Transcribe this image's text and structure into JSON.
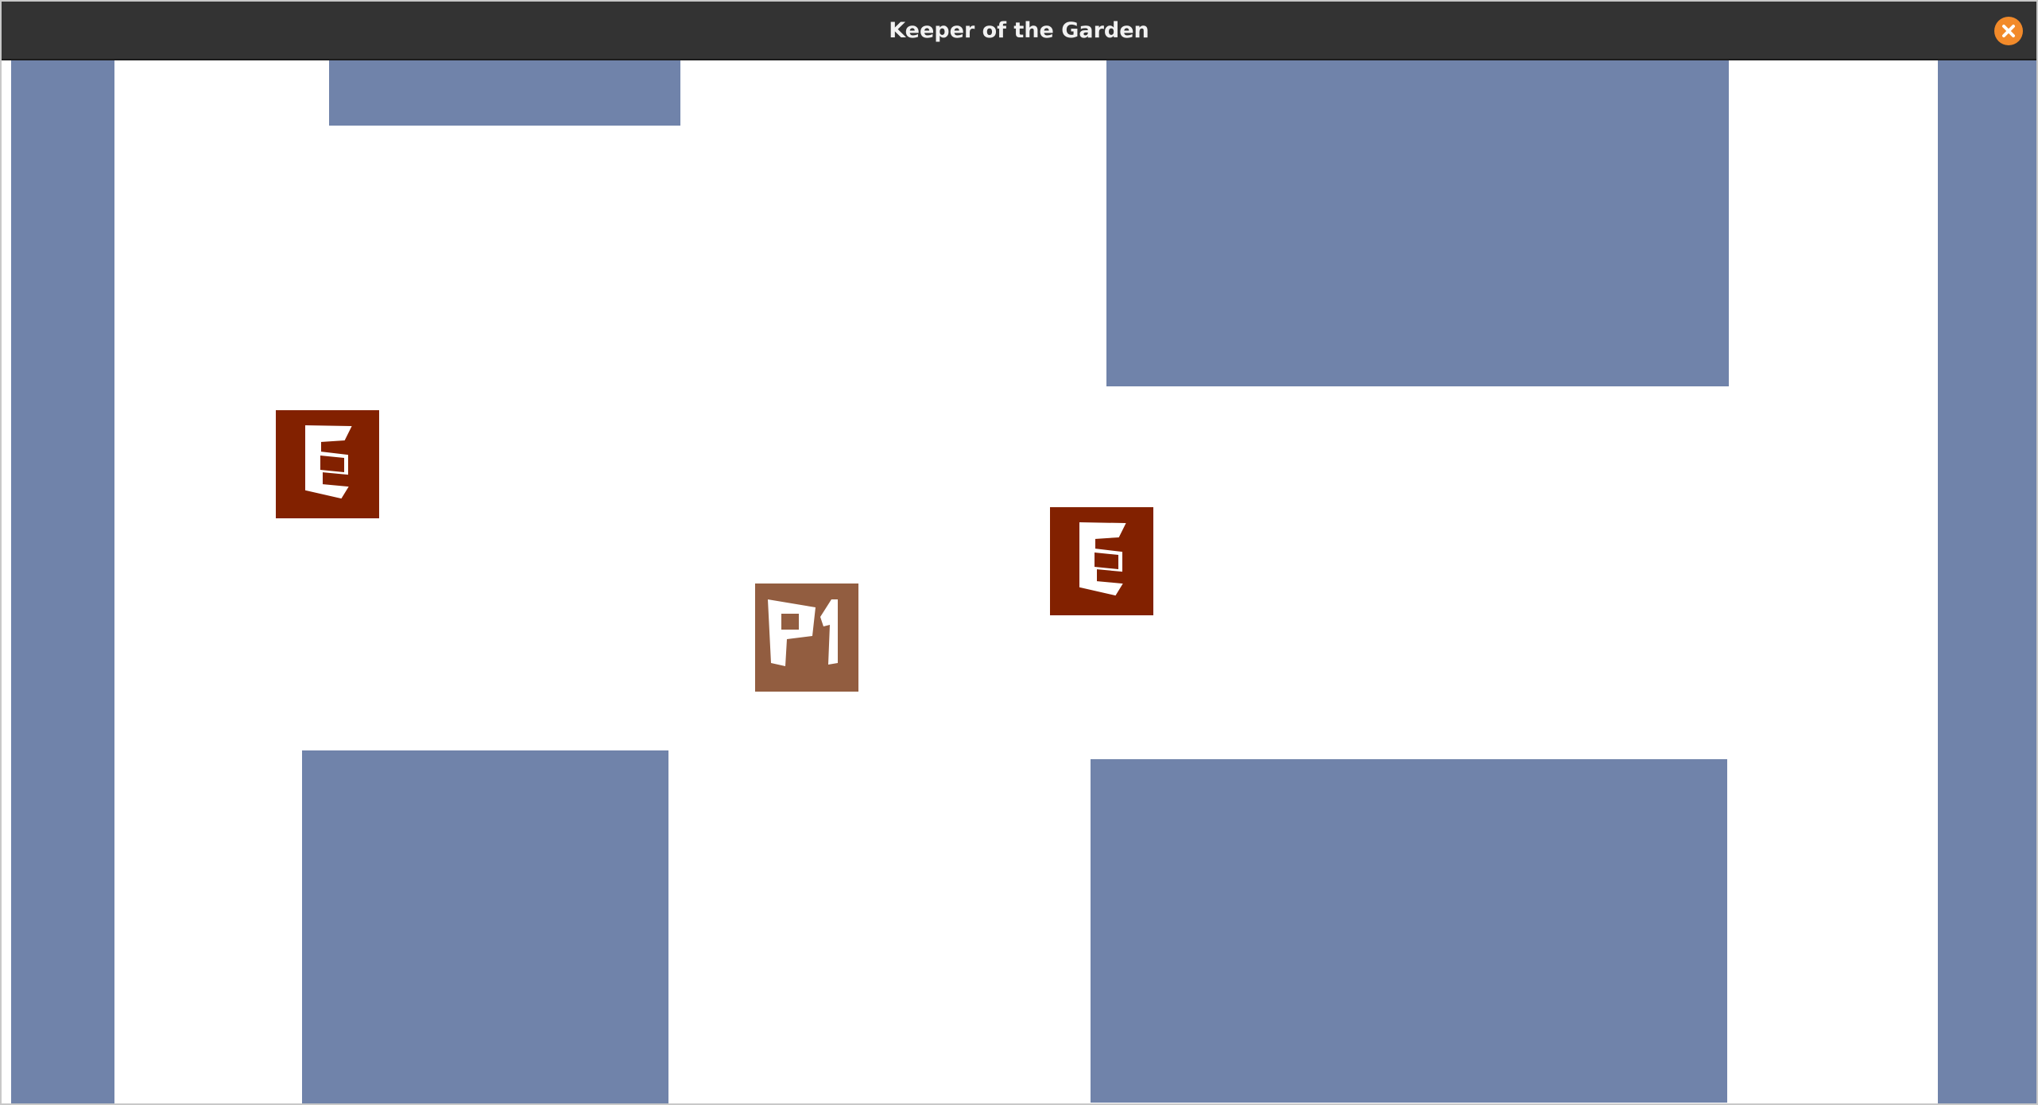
{
  "window": {
    "title": "Keeper of the Garden",
    "close_icon": "close-icon"
  },
  "colors": {
    "titlebar": "#333333",
    "close_button": "#f28a2a",
    "wall": "#7083aa",
    "floor": "#ffffff",
    "enemy": "#822100",
    "player": "#925d40",
    "glyph": "#ffffff"
  },
  "entities": {
    "enemy_label": "E",
    "player_label": "P1"
  }
}
